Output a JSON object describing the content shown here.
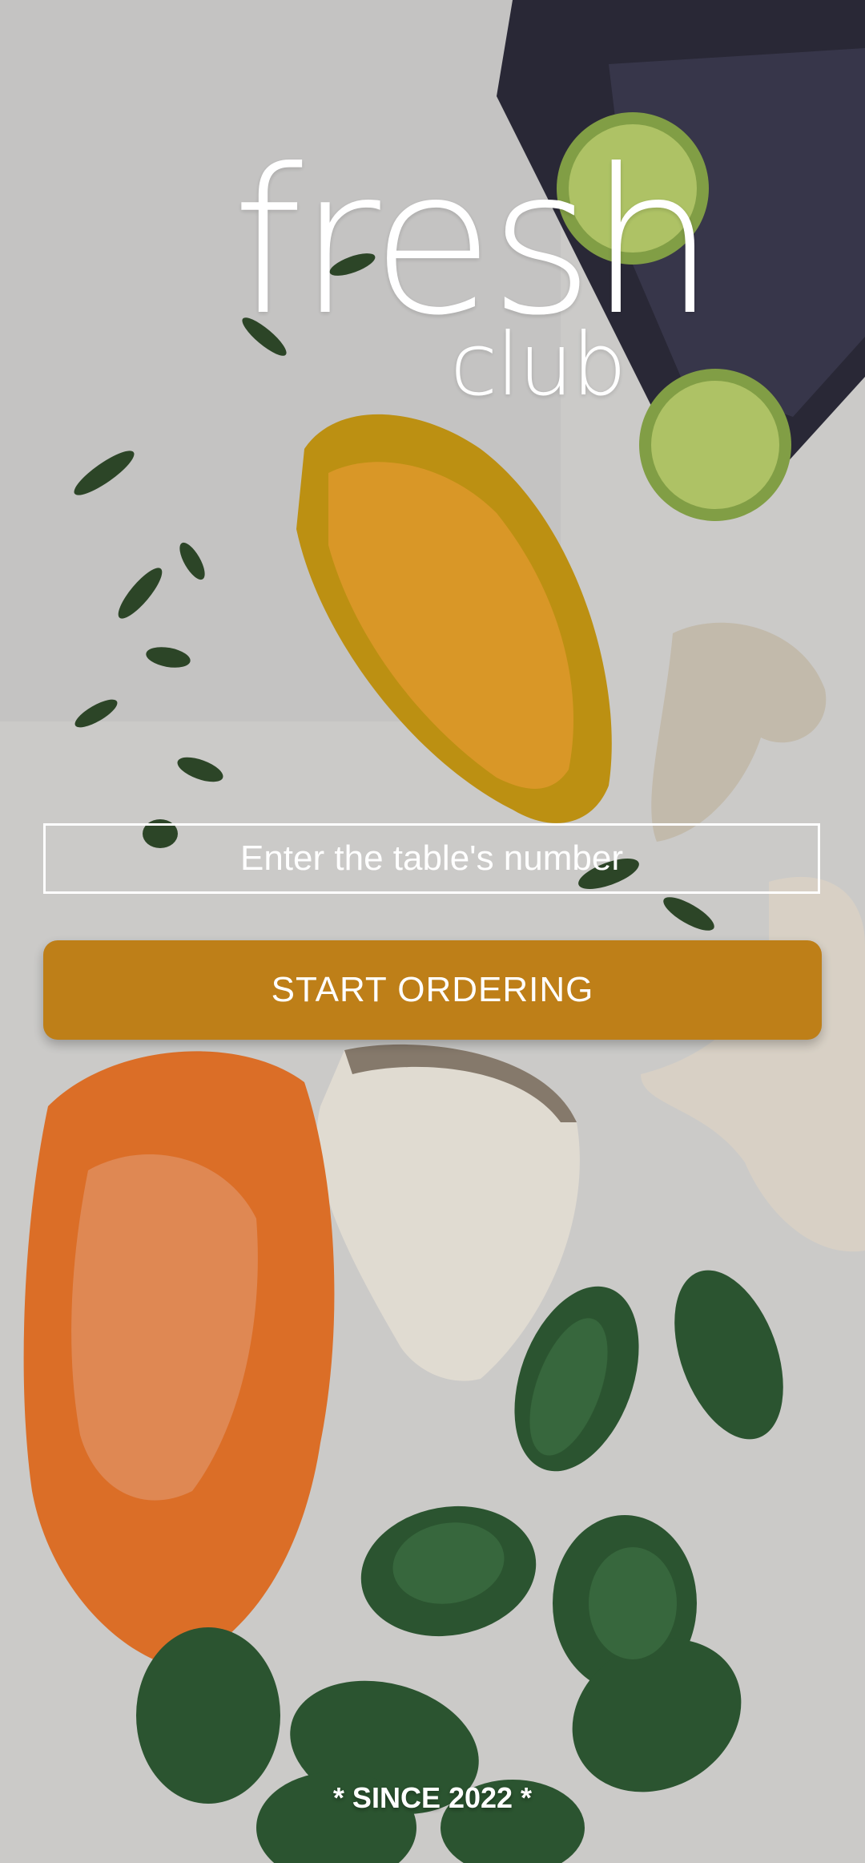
{
  "logo": {
    "word_main": "fresh",
    "word_sub": "club"
  },
  "table_input": {
    "placeholder": "Enter the table's number",
    "value": ""
  },
  "start_button": {
    "label": "START ORDERING"
  },
  "footer": {
    "since_text": "* SINCE 2022 *"
  },
  "colors": {
    "accent": "#BE7F18",
    "text": "#FFFFFF"
  }
}
